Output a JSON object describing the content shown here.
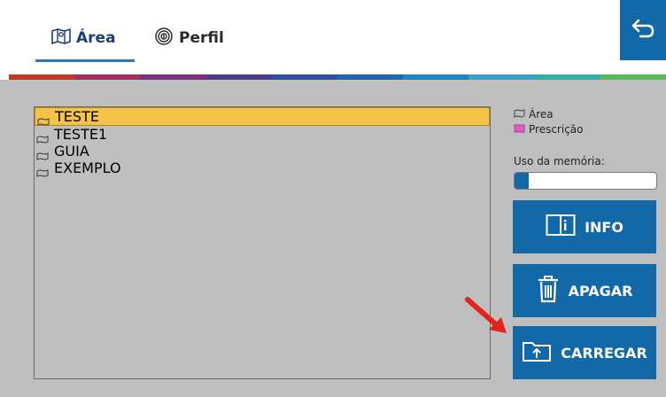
{
  "tabs": {
    "area": {
      "label": "Área",
      "icon": "map-icon"
    },
    "perfil": {
      "label": "Perfil",
      "icon": "fingerprint-icon"
    }
  },
  "header": {
    "back_icon": "back-arrow-icon"
  },
  "stripe_colors": [
    "#c0392b",
    "#a3315f",
    "#7b2e7e",
    "#4b3c8c",
    "#2e4fa0",
    "#1f67b0",
    "#1a86c2",
    "#3aa0c7",
    "#2fb0a3",
    "#5cb85c"
  ],
  "list": {
    "items": [
      {
        "label": "TESTE",
        "selected": true
      },
      {
        "label": "TESTE1",
        "selected": false
      },
      {
        "label": "GUIA",
        "selected": false
      },
      {
        "label": "EXEMPLO",
        "selected": false
      }
    ]
  },
  "legend": {
    "area_label": "Área",
    "prescricao_label": "Prescrição"
  },
  "memory": {
    "label": "Uso da memória:",
    "usage_fraction": 0.1
  },
  "buttons": {
    "info": "INFO",
    "apagar": "APAGAR",
    "carregar": "CARREGAR"
  },
  "colors": {
    "accent": "#1368a8",
    "selection": "#f4c44a",
    "panel": "#bfbfbf",
    "arrow": "#e2231a"
  }
}
